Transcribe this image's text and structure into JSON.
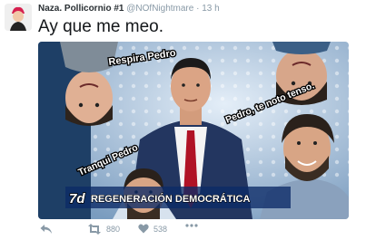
{
  "tweet": {
    "display_name": "Naza. Pollicornio #1",
    "handle": "@NOfNightmare",
    "separator": "·",
    "time": "13 h",
    "text": "Ay que me meo."
  },
  "media": {
    "overlay_labels": {
      "top": "Respira Pedro",
      "right": "Pedro, te noto tenso.",
      "left": "Tranqui Pedro"
    },
    "channel_logo": "7d",
    "banner": "REGENERACIÓN DEMOCRÁTICA"
  },
  "actions": {
    "reply_icon": "reply-icon",
    "retweet_icon": "retweet-icon",
    "retweet_count": "880",
    "like_icon": "heart-icon",
    "like_count": "538",
    "more_icon": "more-icon"
  },
  "colors": {
    "text_primary": "#14171a",
    "text_muted": "#8899a6",
    "banner_bg": "#0c2a66",
    "studio_bg": "#bfd7ee"
  }
}
